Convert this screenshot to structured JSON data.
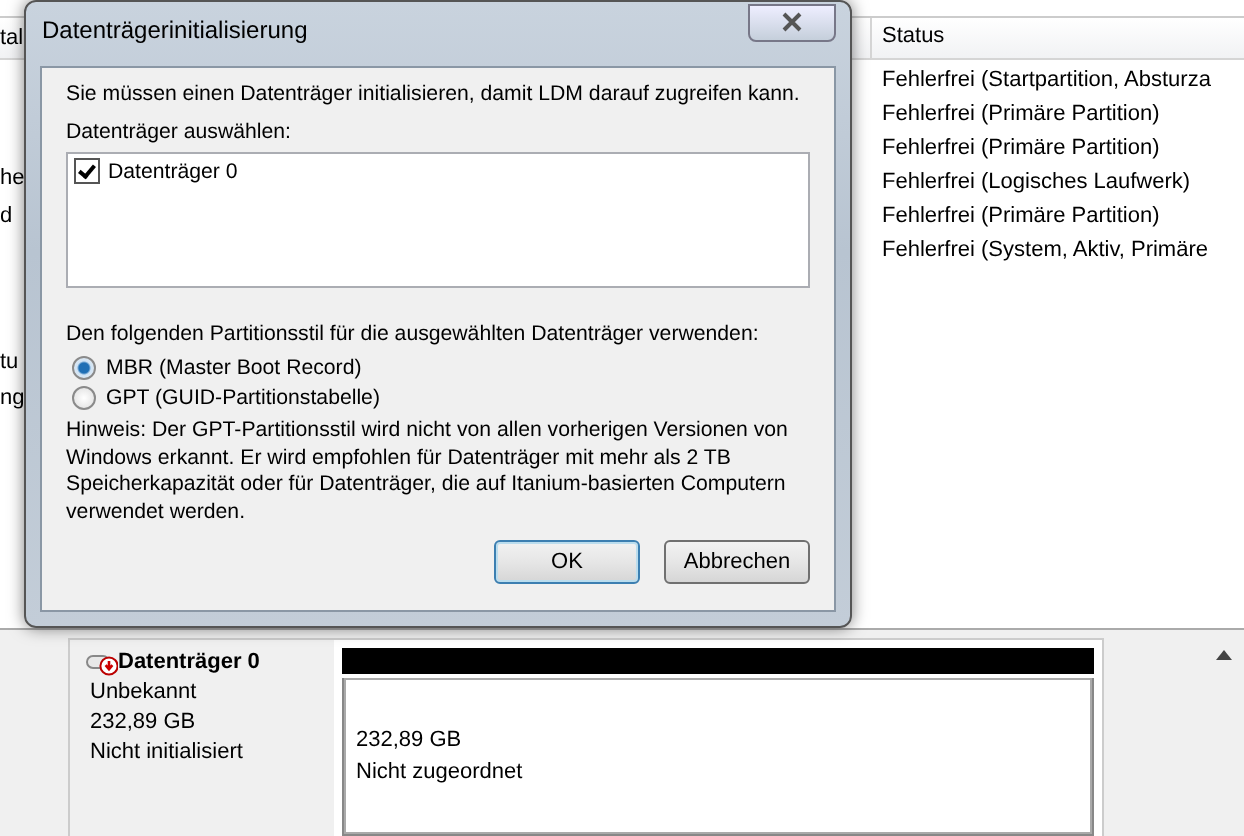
{
  "background": {
    "left_fragments": [
      "tal",
      "he",
      "d",
      "tu",
      "ng"
    ],
    "status_column": {
      "header": "Status",
      "rows": [
        "Fehlerfrei (Startpartition, Absturza",
        "Fehlerfrei (Primäre Partition)",
        "Fehlerfrei (Primäre Partition)",
        "Fehlerfrei (Logisches Laufwerk)",
        "Fehlerfrei (Primäre Partition)",
        "Fehlerfrei (System, Aktiv, Primäre"
      ]
    },
    "disk": {
      "name": "Datenträger 0",
      "type": "Unbekannt",
      "size": "232,89 GB",
      "state": "Nicht initialisiert",
      "partition": {
        "size": "232,89 GB",
        "label": "Nicht zugeordnet"
      }
    }
  },
  "dialog": {
    "title": "Datenträgerinitialisierung",
    "intro": "Sie müssen einen Datenträger initialisieren, damit LDM darauf zugreifen kann.",
    "select_label": "Datenträger auswählen:",
    "disks": [
      {
        "label": "Datenträger 0",
        "checked": true
      }
    ],
    "style_label": "Den folgenden Partitionsstil für die ausgewählten Datenträger verwenden:",
    "styles": [
      {
        "label": "MBR (Master Boot Record)",
        "selected": true
      },
      {
        "label": "GPT (GUID-Partitionstabelle)",
        "selected": false
      }
    ],
    "note": "Hinweis: Der GPT-Partitionsstil wird nicht von allen vorherigen Versionen von Windows erkannt. Er wird empfohlen für Datenträger mit mehr als 2 TB Speicherkapazität oder für Datenträger, die auf Itanium-basierten Computern verwendet werden.",
    "buttons": [
      "OK",
      "Abbrechen"
    ]
  }
}
